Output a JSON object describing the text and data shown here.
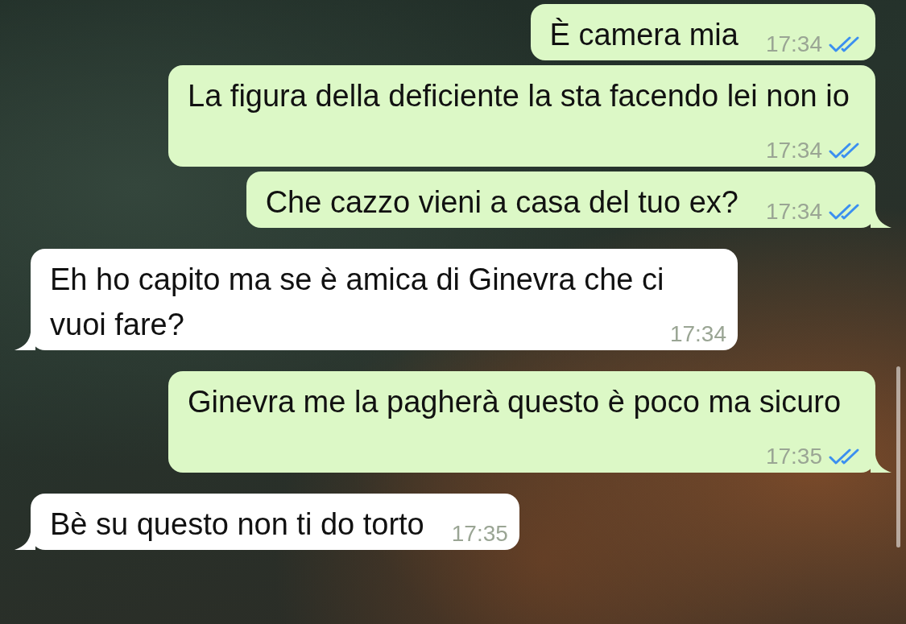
{
  "messages": [
    {
      "kind": "outgoing",
      "text": "È camera mia",
      "time": "17:34",
      "read": true,
      "tail": false
    },
    {
      "kind": "outgoing",
      "text": "La figura della deficiente la sta facendo lei non io",
      "time": "17:34",
      "read": true,
      "tail": false
    },
    {
      "kind": "outgoing",
      "text": "Che cazzo vieni a casa del tuo ex?",
      "time": "17:34",
      "read": true,
      "tail": true
    },
    {
      "kind": "incoming",
      "text": "Eh ho capito ma se è amica di Ginevra che ci vuoi fare?",
      "time": "17:34",
      "tail": true
    },
    {
      "kind": "outgoing",
      "text": "Ginevra me la pagherà questo è poco ma sicuro",
      "time": "17:35",
      "read": true,
      "tail": true
    },
    {
      "kind": "incoming",
      "text": "Bè su questo non ti do torto",
      "time": "17:35",
      "tail": true
    }
  ]
}
